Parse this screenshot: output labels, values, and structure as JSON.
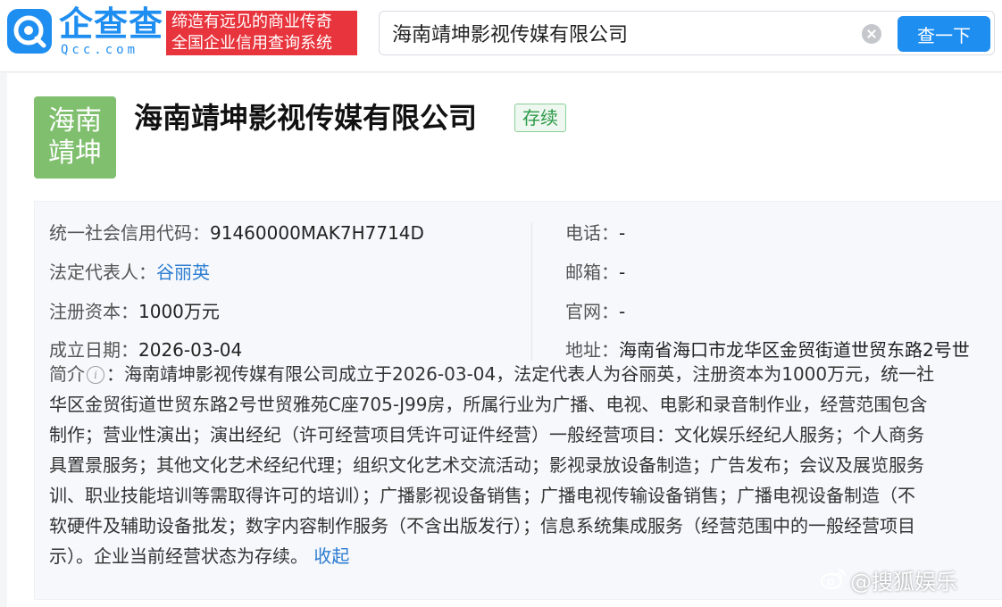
{
  "header": {
    "logo_cn": "企查查",
    "logo_en": "Qcc.com",
    "slogan_line1": "缔造有远见的商业传奇",
    "slogan_line2": "全国企业信用查询系统",
    "search_value": "海南靖坤影视传媒有限公司",
    "search_button": "查一下"
  },
  "company": {
    "logo_line1": "海南",
    "logo_line2": "靖坤",
    "name": "海南靖坤影视传媒有限公司",
    "status": "存续"
  },
  "info": {
    "credit_code_label": "统一社会信用代码：",
    "credit_code": "91460000MAK7H7714D",
    "legal_rep_label": "法定代表人：",
    "legal_rep": "谷丽英",
    "capital_label": "注册资本：",
    "capital": "1000万元",
    "founded_label": "成立日期：",
    "founded": "2026-03-04",
    "phone_label": "电话：",
    "phone": "-",
    "email_label": "邮箱：",
    "email": "-",
    "website_label": "官网：",
    "website": "-",
    "address_label": "地址：",
    "address": "海南省海口市龙华区金贸街道世贸东路2号世"
  },
  "intro": {
    "label": "简介",
    "colon": "：",
    "line1": "海南靖坤影视传媒有限公司成立于2026-03-04，法定代表人为谷丽英，注册资本为1000万元，统一社",
    "line2": "华区金贸街道世贸东路2号世贸雅苑C座705-J99房，所属行业为广播、电视、电影和录音制作业，经营范围包含",
    "line3": "制作；营业性演出；演出经纪（许可经营项目凭许可证件经营）一般经营项目：文化娱乐经纪人服务；个人商务",
    "line4": "具置景服务；其他文化艺术经纪代理；组织文化艺术交流活动；影视录放设备制造；广告发布；会议及展览服务",
    "line5": "训、职业技能培训等需取得许可的培训）；广播影视设备销售；广播电视传输设备销售；广播电视设备制造（不",
    "line6": "软硬件及辅助设备批发；数字内容制作服务（不含出版发行）；信息系统集成服务（经营范围中的一般经营项目",
    "line7": "示）。企业当前经营状态为存续。",
    "collapse": "收起"
  },
  "watermark": "@搜狐娱乐",
  "colors": {
    "brand_blue": "#1f8ef1",
    "slogan_red": "#e8343c",
    "logo_green": "#7fbf6e",
    "status_green": "#2c9a47",
    "link_blue": "#2d7dd2"
  }
}
